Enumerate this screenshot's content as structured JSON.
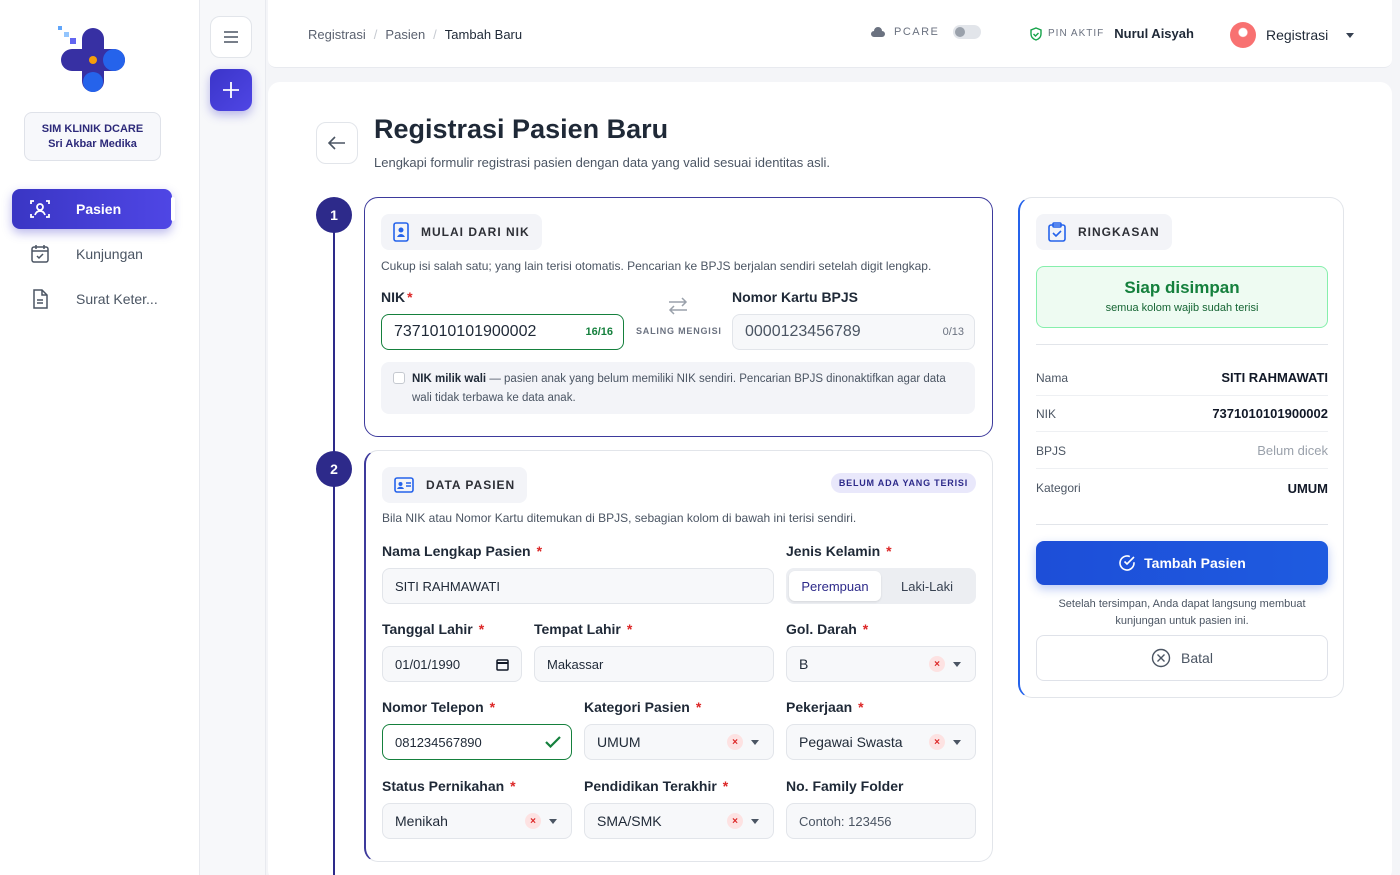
{
  "sidebar": {
    "clinic_line1": "SIM KLINIK DCARE",
    "clinic_line2": "Sri Akbar Medika",
    "items": [
      {
        "label": "Pasien",
        "icon": "patient-icon",
        "active": true
      },
      {
        "label": "Kunjungan",
        "icon": "calendar-icon"
      },
      {
        "label": "Surat Keter...",
        "icon": "document-icon"
      }
    ]
  },
  "header": {
    "breadcrumb": [
      "Registrasi",
      "Pasien",
      "Tambah Baru"
    ],
    "pcare_label": "PCARE",
    "pin_label": "PIN AKTIF",
    "user_name": "Nurul Aisyah",
    "account_label": "Registrasi"
  },
  "page": {
    "title": "Registrasi Pasien Baru",
    "subtitle": "Lengkapi formulir registrasi pasien dengan data yang valid sesuai identitas asli."
  },
  "step1": {
    "number": "1",
    "heading": "MULAI DARI NIK",
    "hint": "Cukup isi salah satu; yang lain terisi otomatis. Pencarian ke BPJS berjalan sendiri setelah digit lengkap.",
    "nik_label": "NIK",
    "nik_value": "7371010101900002",
    "nik_counter": "16/16",
    "swap_label": "SALING MENGISI",
    "bpjs_label": "Nomor Kartu BPJS",
    "bpjs_placeholder": "0000123456789",
    "bpjs_counter": "0/13",
    "wali_bold": "NIK milik wali",
    "wali_text": " — pasien anak yang belum memiliki NIK sendiri. Pencarian BPJS dinonaktifkan agar data wali tidak terbawa ke data anak."
  },
  "step2": {
    "number": "2",
    "heading": "DATA PASIEN",
    "badge": "BELUM ADA YANG TERISI",
    "hint": "Bila NIK atau Nomor Kartu ditemukan di BPJS, sebagian kolom di bawah ini terisi sendiri.",
    "nama_label": "Nama Lengkap Pasien",
    "nama_value": "SITI RAHMAWATI",
    "gender_label": "Jenis Kelamin",
    "gender_options": [
      "Perempuan",
      "Laki-Laki"
    ],
    "tgl_label": "Tanggal Lahir",
    "tgl_value": "01/01/1990",
    "tempat_label": "Tempat Lahir",
    "tempat_value": "Makassar",
    "goldar_label": "Gol. Darah",
    "goldar_value": "B",
    "telp_label": "Nomor Telepon",
    "telp_value": "081234567890",
    "kategori_label": "Kategori Pasien",
    "kategori_value": "UMUM",
    "pekerjaan_label": "Pekerjaan",
    "pekerjaan_value": "Pegawai Swasta",
    "status_label": "Status Pernikahan",
    "status_value": "Menikah",
    "pendidikan_label": "Pendidikan Terakhir",
    "pendidikan_value": "SMA/SMK",
    "folder_label": "No. Family Folder",
    "folder_placeholder": "Contoh: 123456"
  },
  "summary": {
    "heading": "RINGKASAN",
    "ready_title": "Siap disimpan",
    "ready_sub": "semua kolom wajib sudah terisi",
    "rows": [
      {
        "k": "Nama",
        "v": "SITI RAHMAWATI"
      },
      {
        "k": "NIK",
        "v": "7371010101900002"
      },
      {
        "k": "BPJS",
        "v": "Belum dicek"
      },
      {
        "k": "Kategori",
        "v": "UMUM"
      }
    ],
    "primary": "Tambah Pasien",
    "after_save": "Setelah tersimpan, Anda dapat langsung membuat kunjungan untuk pasien ini.",
    "cancel": "Batal"
  },
  "colors": {
    "primary": "#3b35c9",
    "accent_blue": "#1d4ed8",
    "success": "#15803d",
    "danger": "#dc2626"
  }
}
